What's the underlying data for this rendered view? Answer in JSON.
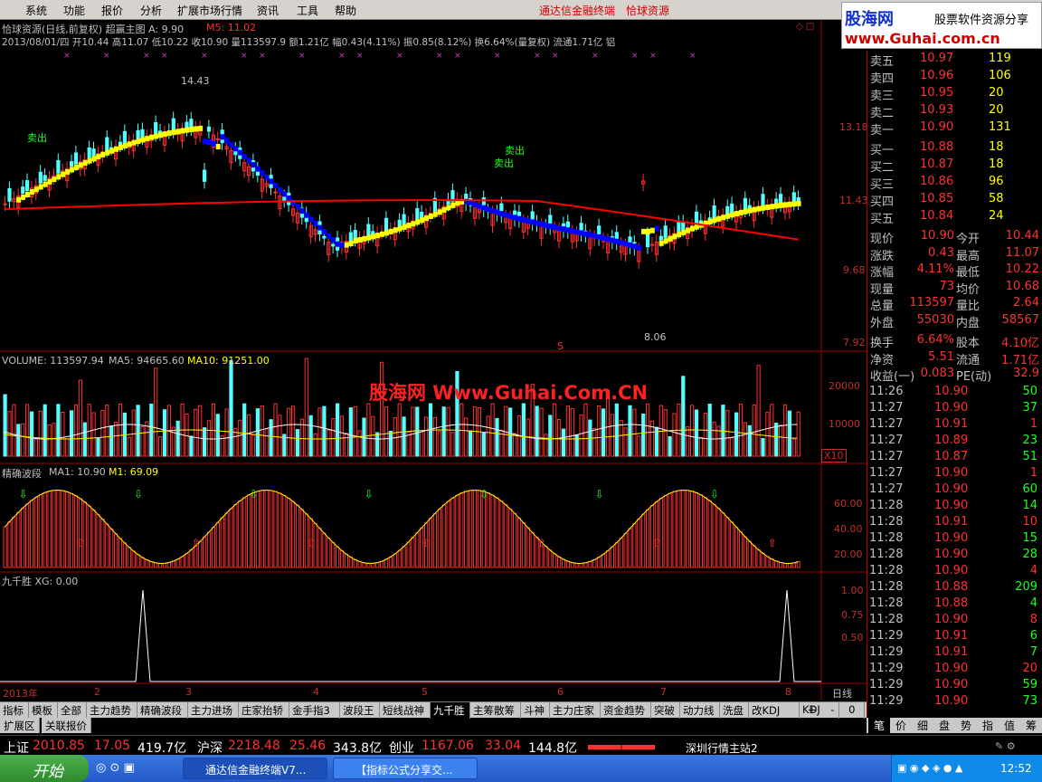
{
  "menu": {
    "items": [
      "系统",
      "功能",
      "报价",
      "分析",
      "扩展市场行情",
      "资讯",
      "工具",
      "帮助"
    ],
    "brand1": "通达信金融终端",
    "brand2": "恰球资源"
  },
  "logo": {
    "l1": "股海网",
    "l1b": "股票软件资源分享",
    "l2": "www.Guhai.com.cn"
  },
  "info": {
    "title": "恰球资源(日线,前复权) 超赢主图 A: 9.90",
    "m5": "M5: 11.02",
    "line2": "2013/08/01/四 开10.44 高11.07 低10.22 收10.90 量113597.9 额1.21亿 幅0.43(4.11%) 振0.85(8.12%) 换6.64%(量复权) 流通1.71亿 铝"
  },
  "price_labels": [
    "13.18",
    "11.43",
    "9.68",
    "7.92"
  ],
  "annotations": {
    "hi": "14.43",
    "lo": "8.06",
    "sell": "卖出",
    "s": "S"
  },
  "vol": {
    "line": "VOLUME: 113597.94",
    "ma5": "MA5: 94665.60",
    "ma10": "MA10: 91251.00",
    "ticks": [
      "20000",
      "10000"
    ],
    "x10": "X10"
  },
  "watermark": "股海网 Www.Guhai.Com.CN",
  "wave": {
    "line": "精确波段",
    "ma1": "MA1: 10.90",
    "m1": "M1: 69.09",
    "ticks": [
      "60.00",
      "40.00",
      "20.00"
    ]
  },
  "jqs": {
    "line": "九千胜 XG: 0.00",
    "ticks": [
      "1.00",
      "0.75",
      "0.50"
    ]
  },
  "xaxis": {
    "labels": [
      "2013年",
      "2",
      "3",
      "4",
      "5",
      "6",
      "7",
      "8"
    ],
    "period": "日线"
  },
  "orderbook": [
    [
      "卖五",
      "10.97",
      "119"
    ],
    [
      "卖四",
      "10.96",
      "106"
    ],
    [
      "卖三",
      "10.95",
      "20"
    ],
    [
      "卖二",
      "10.93",
      "20"
    ],
    [
      "卖一",
      "10.90",
      "131"
    ],
    [
      "买一",
      "10.88",
      "18"
    ],
    [
      "买二",
      "10.87",
      "18"
    ],
    [
      "买三",
      "10.86",
      "96"
    ],
    [
      "买四",
      "10.85",
      "58"
    ],
    [
      "买五",
      "10.84",
      "24"
    ]
  ],
  "quote": [
    [
      "现价",
      "10.90",
      "今开",
      "10.44"
    ],
    [
      "涨跌",
      "0.43",
      "最高",
      "11.07"
    ],
    [
      "涨幅",
      "4.11%",
      "最低",
      "10.22"
    ],
    [
      "现量",
      "73",
      "均价",
      "10.68"
    ],
    [
      "总量",
      "113597",
      "量比",
      "2.64"
    ],
    [
      "外盘",
      "55030",
      "内盘",
      "58567"
    ],
    [
      "换手",
      "6.64%",
      "股本",
      "4.10亿"
    ],
    [
      "净资",
      "5.51",
      "流通",
      "1.71亿"
    ],
    [
      "收益(一)",
      "0.083",
      "PE(动)",
      "32.9"
    ]
  ],
  "ticks": [
    [
      "11:26",
      "10.90",
      "50"
    ],
    [
      "11:27",
      "10.90",
      "37"
    ],
    [
      "11:27",
      "10.91",
      "1"
    ],
    [
      "11:27",
      "10.89",
      "23"
    ],
    [
      "11:27",
      "10.87",
      "51"
    ],
    [
      "11:27",
      "10.90",
      "1"
    ],
    [
      "11:27",
      "10.90",
      "60"
    ],
    [
      "11:28",
      "10.90",
      "14"
    ],
    [
      "11:28",
      "10.91",
      "10"
    ],
    [
      "11:28",
      "10.90",
      "15"
    ],
    [
      "11:28",
      "10.90",
      "28"
    ],
    [
      "11:28",
      "10.90",
      "4"
    ],
    [
      "11:28",
      "10.88",
      "209"
    ],
    [
      "11:28",
      "10.88",
      "4"
    ],
    [
      "11:28",
      "10.90",
      "8"
    ],
    [
      "11:29",
      "10.91",
      "6"
    ],
    [
      "11:29",
      "10.91",
      "7"
    ],
    [
      "11:29",
      "10.90",
      "20"
    ],
    [
      "11:29",
      "10.90",
      "59"
    ],
    [
      "11:29",
      "10.90",
      "73"
    ]
  ],
  "tabs": [
    "指标",
    "模板",
    "全部",
    "主力趋势",
    "精确波段",
    "主力进场",
    "庄家抬轿",
    "金手指3",
    "波段王",
    "短线战神",
    "九千胜",
    "主筹散筹",
    "斗神",
    "主力庄家",
    "资金趋势",
    "突破",
    "动力线",
    "洗盘",
    "改KDJ",
    "KDJ"
  ],
  "tabs2": [
    "扩展区",
    "关联报价"
  ],
  "rtabs": [
    "笔",
    "价",
    "细",
    "盘",
    "势",
    "指",
    "值",
    "筹"
  ],
  "status": {
    "sh": "上证",
    "sh_v": "2010.85",
    "sh_c": "17.05",
    "sh_a": "419.7亿",
    "sz": "沪深",
    "sz_v": "2218.48",
    "sz_c": "25.46",
    "sz_a": "343.8亿",
    "cy": "创业",
    "cy_v": "1167.06",
    "cy_c": "33.04",
    "cy_a": "144.8亿",
    "station": "深圳行情主站2"
  },
  "taskbar": {
    "start": "开始",
    "t1": "通达信金融终端V7...",
    "t2": "【指标公式分享交...",
    "clock": "12:52"
  },
  "colors": {
    "up": "#ff3030",
    "down": "#54ffff",
    "yellow": "#ffff00",
    "blue": "#0000ff",
    "ma": "#ff0000"
  }
}
